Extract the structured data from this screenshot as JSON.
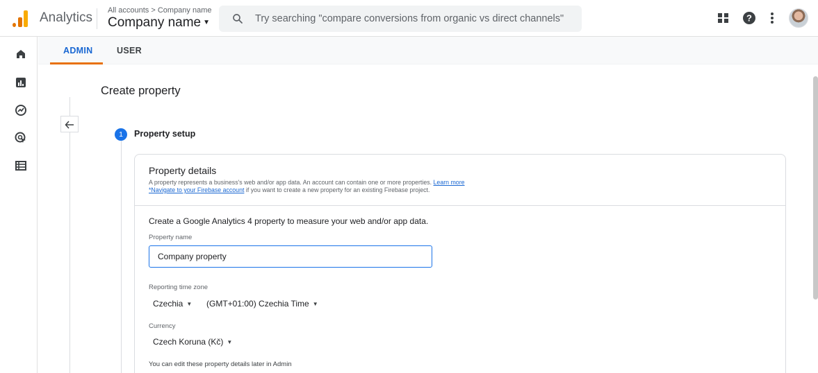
{
  "app": {
    "title": "Analytics",
    "breadcrumb": "All accounts > Company name",
    "account_name": "Company name"
  },
  "search": {
    "placeholder": "Try searching \"compare conversions from organic vs direct channels\""
  },
  "toolbar": {
    "icons": [
      "apps-icon",
      "help-icon",
      "more-vert-icon",
      "avatar"
    ]
  },
  "left_nav": {
    "icons": [
      "home-icon",
      "reports-icon",
      "explore-icon",
      "advertising-icon",
      "configure-icon"
    ]
  },
  "tabs": [
    {
      "label": "ADMIN",
      "active": true
    },
    {
      "label": "USER",
      "active": false
    }
  ],
  "page": {
    "title": "Create property"
  },
  "step": {
    "number": "1",
    "label": "Property setup"
  },
  "property_details": {
    "title": "Property details",
    "desc_line1": "A property represents a business's web and/or app data. An account can contain one or more properties.",
    "learn_more": "Learn more",
    "firebase_link": "*Navigate to your Firebase account",
    "desc_line2_rest": "if you want to create a new property for an existing Firebase project."
  },
  "form": {
    "intro": "Create a Google Analytics 4 property to measure your web and/or app data.",
    "property_name_label": "Property name",
    "property_name_value": "Company property",
    "timezone_label": "Reporting time zone",
    "timezone_country": "Czechia",
    "timezone_value": "(GMT+01:00) Czechia Time",
    "currency_label": "Currency",
    "currency_value": "Czech Koruna (Kč)",
    "note": "You can edit these property details later in Admin"
  },
  "colors": {
    "accent_blue": "#1a73e8",
    "tab_underline": "#e8710a",
    "logo_orange": "#f9ab00"
  }
}
